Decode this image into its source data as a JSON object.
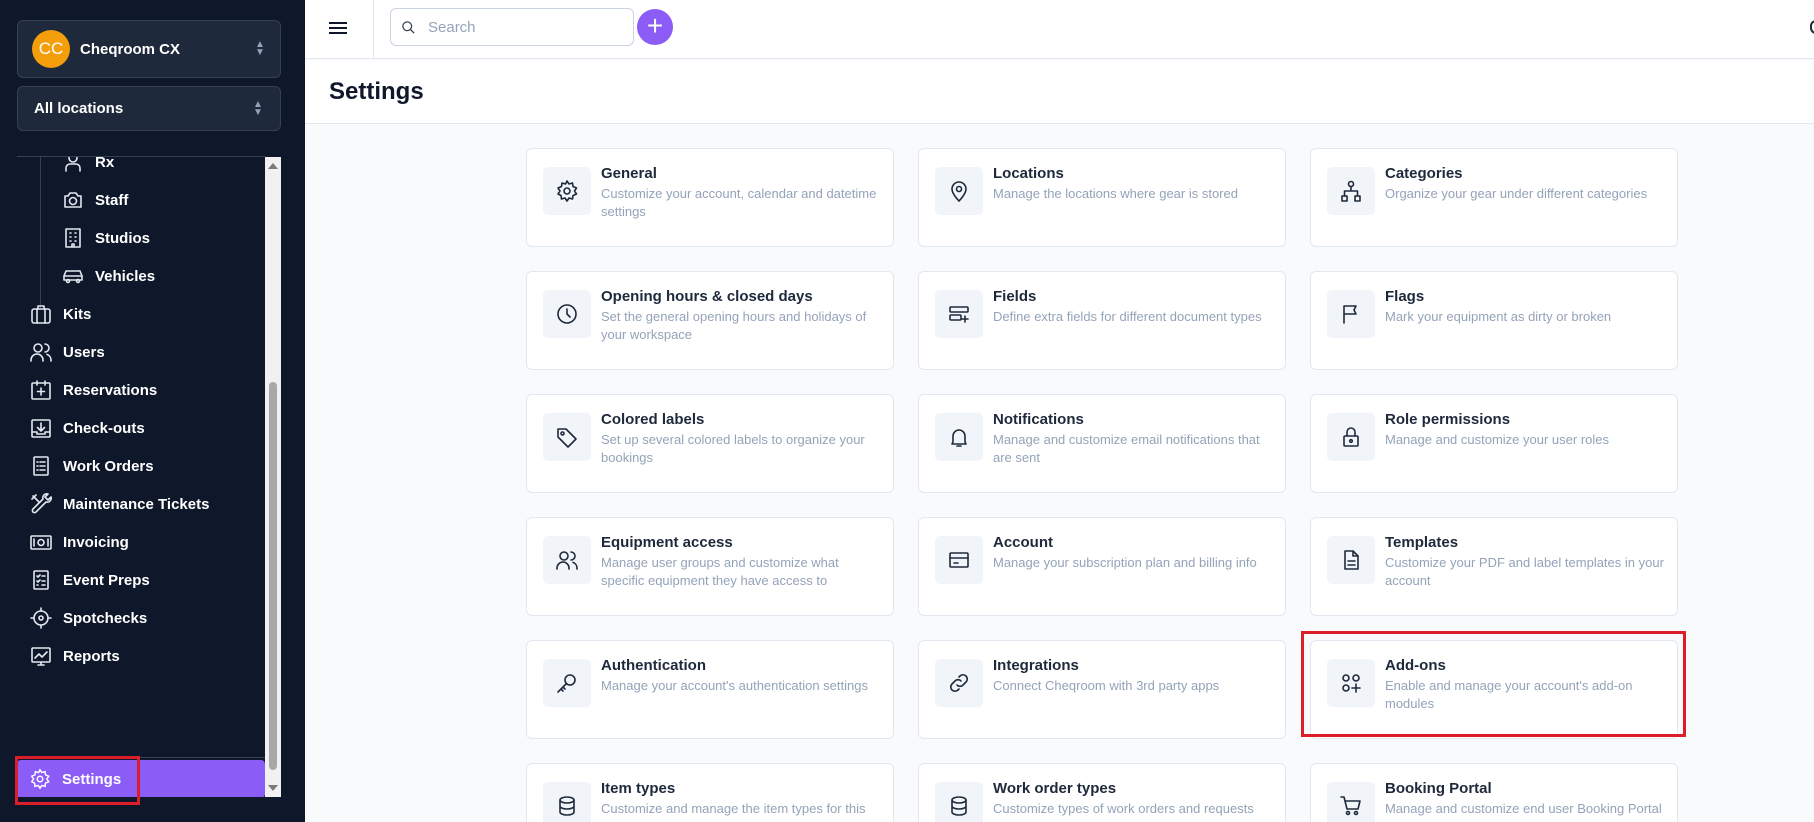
{
  "sidebar": {
    "org": {
      "initials": "CC",
      "name": "Cheqroom CX",
      "avatar_color": "#f59e0b"
    },
    "location": {
      "name": "All locations"
    },
    "sub_items": [
      {
        "label": "Rx",
        "icon": "user-badge-icon"
      },
      {
        "label": "Staff",
        "icon": "camera-icon"
      },
      {
        "label": "Studios",
        "icon": "building-icon"
      },
      {
        "label": "Vehicles",
        "icon": "car-icon"
      }
    ],
    "items": [
      {
        "label": "Kits",
        "icon": "kit-icon"
      },
      {
        "label": "Users",
        "icon": "users-icon"
      },
      {
        "label": "Reservations",
        "icon": "calendar-plus-icon"
      },
      {
        "label": "Check-outs",
        "icon": "tray-download-icon"
      },
      {
        "label": "Work Orders",
        "icon": "clipboard-list-icon"
      },
      {
        "label": "Maintenance Tickets",
        "icon": "tools-icon"
      },
      {
        "label": "Invoicing",
        "icon": "money-icon"
      },
      {
        "label": "Event Preps",
        "icon": "checklist-icon"
      },
      {
        "label": "Spotchecks",
        "icon": "crosshair-icon"
      },
      {
        "label": "Reports",
        "icon": "chart-icon"
      }
    ],
    "active_item": {
      "label": "Settings",
      "icon": "gear-icon"
    },
    "accent_color": "#8b5cf6"
  },
  "topbar": {
    "search_placeholder": "Search",
    "add_label": "+"
  },
  "page": {
    "title": "Settings"
  },
  "cards": [
    {
      "title": "General",
      "desc": "Customize your account, calendar and datetime settings",
      "icon": "gear-icon"
    },
    {
      "title": "Locations",
      "desc": "Manage the locations where gear is stored",
      "icon": "map-pin-icon"
    },
    {
      "title": "Categories",
      "desc": "Organize your gear under different categories",
      "icon": "hierarchy-icon"
    },
    {
      "title": "Opening hours & closed days",
      "desc": "Set the general opening hours and holidays of your workspace",
      "icon": "clock-icon"
    },
    {
      "title": "Fields",
      "desc": "Define extra fields for different document types",
      "icon": "fields-plus-icon"
    },
    {
      "title": "Flags",
      "desc": "Mark your equipment as dirty or broken",
      "icon": "flag-icon"
    },
    {
      "title": "Colored labels",
      "desc": "Set up several colored labels to organize your bookings",
      "icon": "tag-icon"
    },
    {
      "title": "Notifications",
      "desc": "Manage and customize email notifications that are sent",
      "icon": "bell-icon"
    },
    {
      "title": "Role permissions",
      "desc": "Manage and customize your user roles",
      "icon": "lock-icon"
    },
    {
      "title": "Equipment access",
      "desc": "Manage user groups and customize what specific equipment they have access to",
      "icon": "users-icon"
    },
    {
      "title": "Account",
      "desc": "Manage your subscription plan and billing info",
      "icon": "credit-card-icon"
    },
    {
      "title": "Templates",
      "desc": "Customize your PDF and label templates in your account",
      "icon": "document-icon"
    },
    {
      "title": "Authentication",
      "desc": "Manage your account's authentication settings",
      "icon": "key-icon"
    },
    {
      "title": "Integrations",
      "desc": "Connect Cheqroom with 3rd party apps",
      "icon": "link-icon"
    },
    {
      "title": "Add-ons",
      "desc": "Enable and manage your account's add-on modules",
      "icon": "apps-plus-icon"
    },
    {
      "title": "Item types",
      "desc": "Customize and manage the item types for this",
      "icon": "database-icon"
    },
    {
      "title": "Work order types",
      "desc": "Customize types of work orders and requests",
      "icon": "database-icon"
    },
    {
      "title": "Booking Portal",
      "desc": "Manage and customize end user Booking Portal",
      "icon": "cart-icon"
    }
  ],
  "highlight_color": "#dc1e2a"
}
